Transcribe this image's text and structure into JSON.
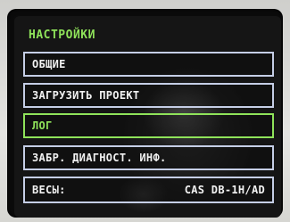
{
  "screen": {
    "title": "НАСТРОЙКИ",
    "menu": [
      {
        "label": "ОБЩИЕ",
        "selected": false
      },
      {
        "label": "ЗАГРУЗИТЬ ПРОЕКТ",
        "selected": false
      },
      {
        "label": "ЛОГ",
        "selected": true
      },
      {
        "label": "ЗАБР. ДИАГНОСТ. ИНФ.",
        "selected": false
      },
      {
        "label": "ВЕСЫ:",
        "value": "CAS DB-1H/AD",
        "selected": false
      }
    ]
  },
  "colors": {
    "accent": "#8fe35a",
    "border": "#c5cee6",
    "background": "#151515",
    "text": "#f1f1f1"
  }
}
